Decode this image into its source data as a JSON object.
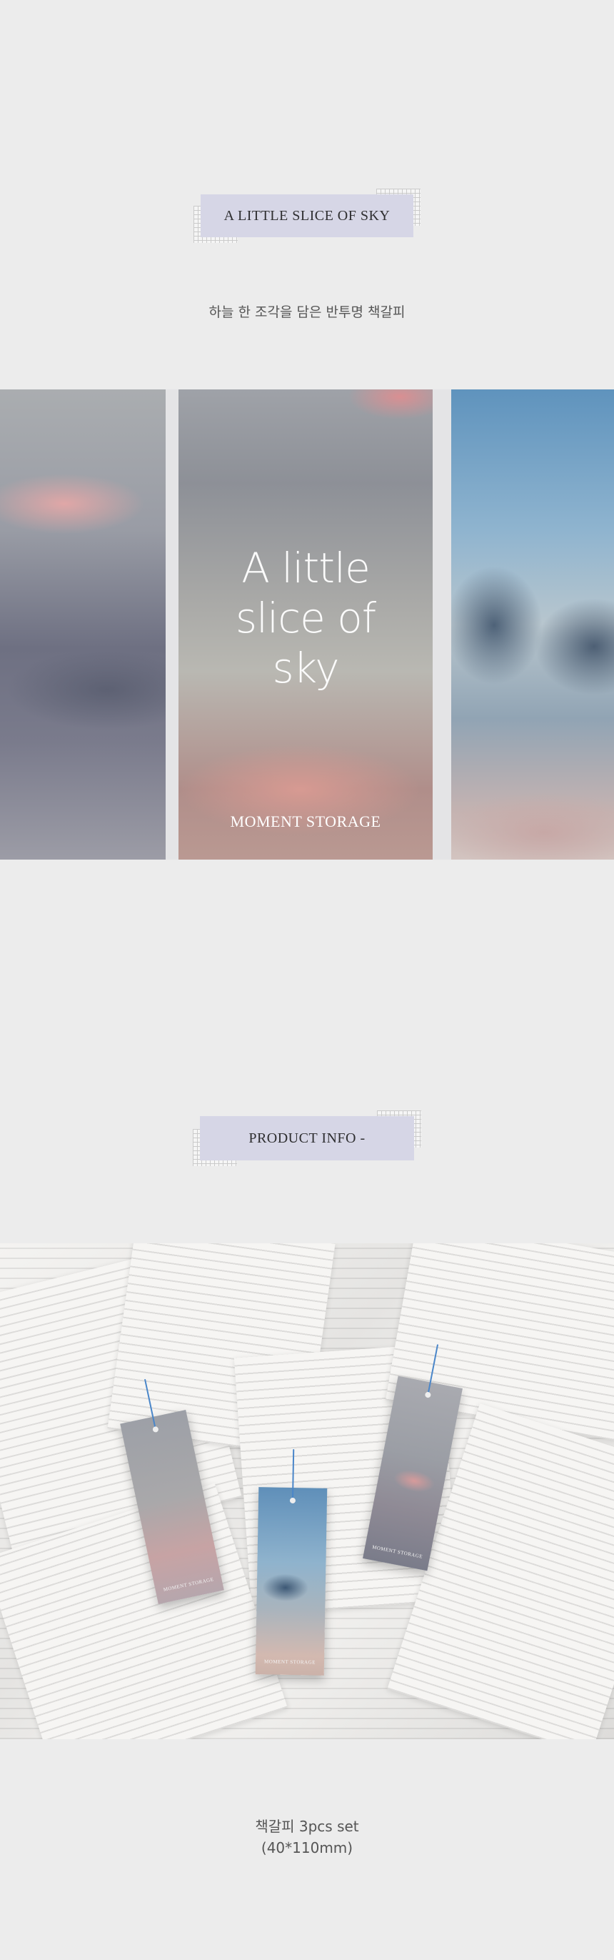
{
  "header_tag": {
    "label": "A LITTLE SLICE OF SKY"
  },
  "subtitle": "하늘 한 조각을 담은 반투명 책갈피",
  "hero": {
    "title_lines": [
      "A little",
      "slice of",
      "sky"
    ],
    "brand": "MOMENT STORAGE"
  },
  "info_tag": {
    "label": "PRODUCT INFO -"
  },
  "product_photo": {
    "bookmark_labels": [
      "MOMENT STORAGE",
      "MOMENT STORAGE",
      "MOMENT STORAGE"
    ]
  },
  "caption": {
    "line1": "책갈피 3pcs set",
    "line2": "(40*110mm)"
  },
  "colors": {
    "background": "#ececec",
    "tag_fill": "#d6d6e6",
    "cord_blue": "#4a86c9"
  }
}
